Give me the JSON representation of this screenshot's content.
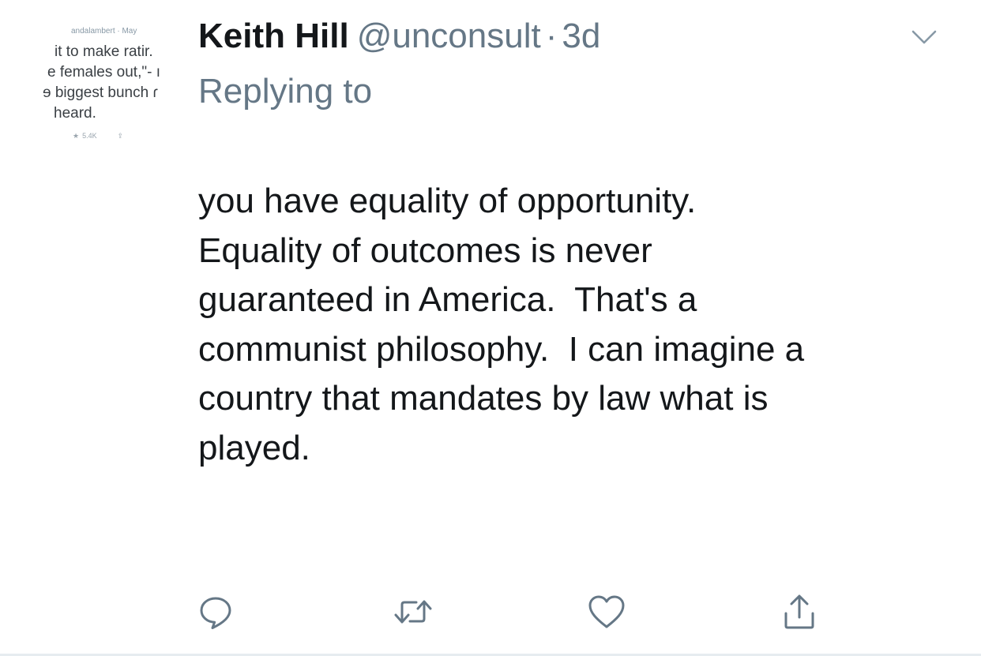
{
  "avatar": {
    "handle_text": "andalambert · May",
    "lines": [
      "it to make ratir.",
      "e females out,\"- ı",
      "ɘ biggest bunch ɾ",
      "heard."
    ],
    "stat_likes": "5.4K"
  },
  "tweet": {
    "author_name": "Keith Hill",
    "author_handle": "@unconsult",
    "separator": "·",
    "time": "3d",
    "replying_to_label": "Replying to",
    "text": "you have equality of opportunity.\nEquality of outcomes is never\nguaranteed in America.  That's a\ncommunist philosophy.  I can imagine a\ncountry that mandates by law what is\nplayed."
  },
  "icons": {
    "menu": "chevron-down-icon",
    "reply": "reply-icon",
    "retweet": "retweet-icon",
    "like": "heart-icon",
    "share": "share-icon"
  },
  "colors": {
    "text_primary": "#14171a",
    "text_secondary": "#657786",
    "icon_gray": "#657786",
    "divider": "#e6ecf0"
  }
}
